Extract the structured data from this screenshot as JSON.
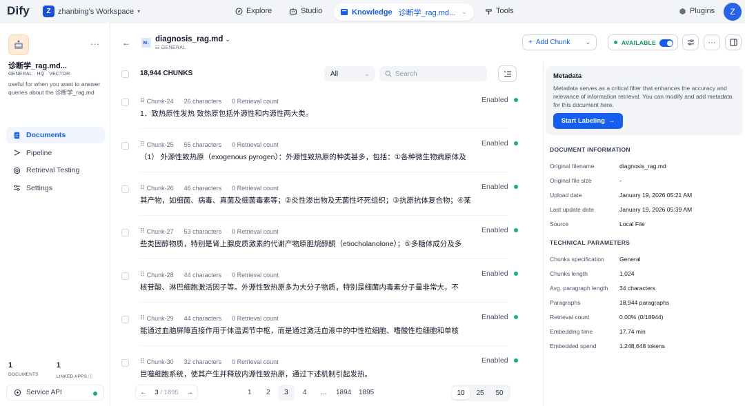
{
  "topbar": {
    "logo": "Dify",
    "workspace_initial": "Z",
    "workspace_name": "zhanbing's Workspace",
    "nav": {
      "explore": "Explore",
      "studio": "Studio",
      "knowledge": "Knowledge",
      "current_dataset": "诊断学_rag.md...",
      "tools": "Tools"
    },
    "plugins": "Plugins",
    "user_initial": "Z"
  },
  "sidebar": {
    "dataset_name": "诊断学_rag.md...",
    "tags": "GENERAL · HQ · VECTOR",
    "description": "useful for when you want to answer queries about the 诊断学_rag.md",
    "nav": [
      "Documents",
      "Pipeline",
      "Retrieval Testing",
      "Settings"
    ],
    "stats": {
      "documents_count": "1",
      "documents_label": "DOCUMENTS",
      "apps_count": "1",
      "apps_label": "LINKED APPS"
    },
    "service_api": "Service API"
  },
  "document": {
    "icon_label": "M↓",
    "name": "diagnosis_rag.md",
    "type": "GENERAL",
    "add_chunk": "Add Chunk",
    "status": "AVAILABLE",
    "chunk_count": "18,944 CHUNKS",
    "filter": "All",
    "search_placeholder": "Search"
  },
  "chunks": [
    {
      "id": "Chunk-24",
      "chars": "26 characters",
      "retrieval": "0 Retrieval count",
      "status": "Enabled",
      "text": "1．致热原性发热 致热原包括外源性和内源性两大类。"
    },
    {
      "id": "Chunk-25",
      "chars": "55 characters",
      "retrieval": "0 Retrieval count",
      "status": "Enabled",
      "text": "（1） 外源性致热原（exogenous pyrogen）：外源性致热原的种类甚多，包括：①各种微生物病原体及"
    },
    {
      "id": "Chunk-26",
      "chars": "46 characters",
      "retrieval": "0 Retrieval count",
      "status": "Enabled",
      "text": "其产物，如细菌、病毒、真菌及细菌毒素等；②炎性渗出物及无菌性坏死组织；③抗原抗体复合物；④某"
    },
    {
      "id": "Chunk-27",
      "chars": "53 characters",
      "retrieval": "0 Retrieval count",
      "status": "Enabled",
      "text": "些类固醇物质，特别是肾上腺皮质激素的代谢产物原胆烷醇酮（etiocholanolone）；⑤多糖体成分及多"
    },
    {
      "id": "Chunk-28",
      "chars": "44 characters",
      "retrieval": "0 Retrieval count",
      "status": "Enabled",
      "text": "核苷酸、淋巴细胞激活因子等。外源性致热原多为大分子物质，特别是细菌内毒素分子量非常大，不"
    },
    {
      "id": "Chunk-29",
      "chars": "44 characters",
      "retrieval": "0 Retrieval count",
      "status": "Enabled",
      "text": "能通过血脑屏障直接作用于体温调节中枢，而是通过激活血液中的中性粒细胞、嗜酸性粒细胞和单核"
    },
    {
      "id": "Chunk-30",
      "chars": "32 characters",
      "retrieval": "0 Retrieval count",
      "status": "Enabled",
      "text": "巨噬细胞系统，使其产生并释放内源性致热原，通过下述机制引起发热。"
    }
  ],
  "pagination": {
    "current": "3",
    "total": "1895",
    "pages": [
      "1",
      "2",
      "3",
      "4",
      "...",
      "1894",
      "1895"
    ],
    "page_sizes": [
      "10",
      "25",
      "50"
    ],
    "selected_size": "10"
  },
  "metadata": {
    "title": "Metadata",
    "description": "Metadata serves as a critical filter that enhances the accuracy and relevance of information retrieval. You can modify and add metadata for this document here.",
    "button": "Start Labeling"
  },
  "doc_info": {
    "heading": "DOCUMENT INFORMATION",
    "rows": [
      {
        "k": "Original filename",
        "v": "diagnosis_rag.md"
      },
      {
        "k": "Original file size",
        "v": "-"
      },
      {
        "k": "Upload date",
        "v": "January 19, 2026 05:21 AM"
      },
      {
        "k": "Last update date",
        "v": "January 19, 2026 05:39 AM"
      },
      {
        "k": "Source",
        "v": "Local File"
      }
    ]
  },
  "tech": {
    "heading": "TECHNICAL PARAMETERS",
    "rows": [
      {
        "k": "Chunks specification",
        "v": "General"
      },
      {
        "k": "Chunks length",
        "v": "1,024"
      },
      {
        "k": "Avg. paragraph length",
        "v": "34 characters"
      },
      {
        "k": "Paragraphs",
        "v": "18,944 paragraphs"
      },
      {
        "k": "Retrieval count",
        "v": "0.00% (0/18944)"
      },
      {
        "k": "Embedding time",
        "v": "17.74 min"
      },
      {
        "k": "Embedded spend",
        "v": "1,248,648 tokens"
      }
    ]
  }
}
